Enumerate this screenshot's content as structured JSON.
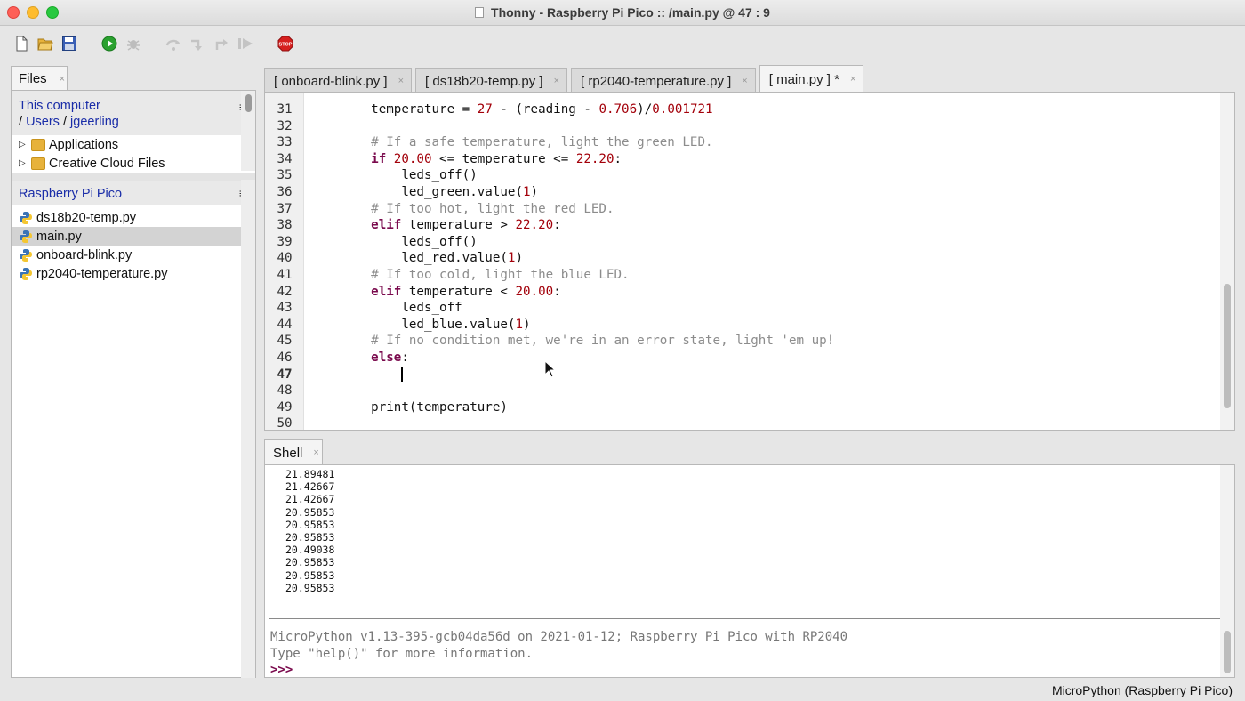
{
  "window": {
    "title": "Thonny  -  Raspberry Pi Pico :: /main.py  @  47 : 9"
  },
  "toolbar": {
    "buttons": [
      "new-file",
      "open-file",
      "save",
      "run",
      "debug",
      "step-over",
      "step-into",
      "step-out",
      "resume",
      "stop"
    ],
    "stop_label": "STOP"
  },
  "files_panel": {
    "tab_label": "Files",
    "computer": {
      "title": "This computer",
      "path_sep": "/",
      "path_users": "Users",
      "path_user": "jgeerling",
      "items": [
        "Applications",
        "Creative Cloud Files"
      ]
    },
    "pico": {
      "title": "Raspberry Pi Pico",
      "files": [
        "ds18b20-temp.py",
        "main.py",
        "onboard-blink.py",
        "rp2040-temperature.py"
      ],
      "selected": "main.py"
    },
    "menu_glyph": "≡"
  },
  "editor": {
    "tabs": [
      {
        "label": "[ onboard-blink.py ]",
        "active": false
      },
      {
        "label": "[ ds18b20-temp.py ]",
        "active": false
      },
      {
        "label": "[ rp2040-temperature.py ]",
        "active": false
      },
      {
        "label": "[ main.py ] *",
        "active": true
      }
    ],
    "tab_close": "×",
    "lines": [
      {
        "n": "31",
        "parts": [
          [
            "t",
            "    temperature = "
          ],
          [
            "n",
            "27"
          ],
          [
            "t",
            " - (reading - "
          ],
          [
            "n",
            "0.706"
          ],
          [
            "t",
            ")/"
          ],
          [
            "n",
            "0.001721"
          ]
        ]
      },
      {
        "n": "32",
        "parts": []
      },
      {
        "n": "33",
        "parts": [
          [
            "c",
            "    # If a safe temperature, light the green LED."
          ]
        ]
      },
      {
        "n": "34",
        "parts": [
          [
            "k",
            "    if "
          ],
          [
            "n",
            "20.00"
          ],
          [
            "t",
            " <= temperature <= "
          ],
          [
            "n",
            "22.20"
          ],
          [
            "t",
            ":"
          ]
        ]
      },
      {
        "n": "35",
        "parts": [
          [
            "t",
            "        leds_off()"
          ]
        ]
      },
      {
        "n": "36",
        "parts": [
          [
            "t",
            "        led_green.value("
          ],
          [
            "n",
            "1"
          ],
          [
            "t",
            ")"
          ]
        ]
      },
      {
        "n": "37",
        "parts": [
          [
            "c",
            "    # If too hot, light the red LED."
          ]
        ]
      },
      {
        "n": "38",
        "parts": [
          [
            "k",
            "    elif "
          ],
          [
            "t",
            "temperature > "
          ],
          [
            "n",
            "22.20"
          ],
          [
            "t",
            ":"
          ]
        ]
      },
      {
        "n": "39",
        "parts": [
          [
            "t",
            "        leds_off()"
          ]
        ]
      },
      {
        "n": "40",
        "parts": [
          [
            "t",
            "        led_red.value("
          ],
          [
            "n",
            "1"
          ],
          [
            "t",
            ")"
          ]
        ]
      },
      {
        "n": "41",
        "parts": [
          [
            "c",
            "    # If too cold, light the blue LED."
          ]
        ]
      },
      {
        "n": "42",
        "parts": [
          [
            "k",
            "    elif "
          ],
          [
            "t",
            "temperature < "
          ],
          [
            "n",
            "20.00"
          ],
          [
            "t",
            ":"
          ]
        ]
      },
      {
        "n": "43",
        "parts": [
          [
            "t",
            "        leds_off"
          ]
        ]
      },
      {
        "n": "44",
        "parts": [
          [
            "t",
            "        led_blue.value("
          ],
          [
            "n",
            "1"
          ],
          [
            "t",
            ")"
          ]
        ]
      },
      {
        "n": "45",
        "parts": [
          [
            "c",
            "    # If no condition met, we're in an error state, light 'em up!"
          ]
        ]
      },
      {
        "n": "46",
        "parts": [
          [
            "k",
            "    else"
          ],
          [
            "t",
            ":"
          ]
        ]
      },
      {
        "n": "47",
        "parts": [
          [
            "t",
            "        "
          ],
          [
            "cursor",
            ""
          ]
        ]
      },
      {
        "n": "48",
        "parts": []
      },
      {
        "n": "49",
        "parts": [
          [
            "t",
            "    print(temperature)"
          ]
        ]
      },
      {
        "n": "50",
        "parts": []
      }
    ]
  },
  "shell": {
    "tab_label": "Shell",
    "output": [
      "21.89481",
      "21.42667",
      "21.42667",
      "20.95853",
      "20.95853",
      "20.95853",
      "20.49038",
      "20.95853",
      "20.95853",
      "20.95853"
    ],
    "banner": "MicroPython v1.13-395-gcb04da56d on 2021-01-12; Raspberry Pi Pico with RP2040",
    "help": "Type \"help()\" for more information.",
    "prompt": ">>>"
  },
  "status": {
    "interpreter": "MicroPython (Raspberry Pi Pico)"
  }
}
